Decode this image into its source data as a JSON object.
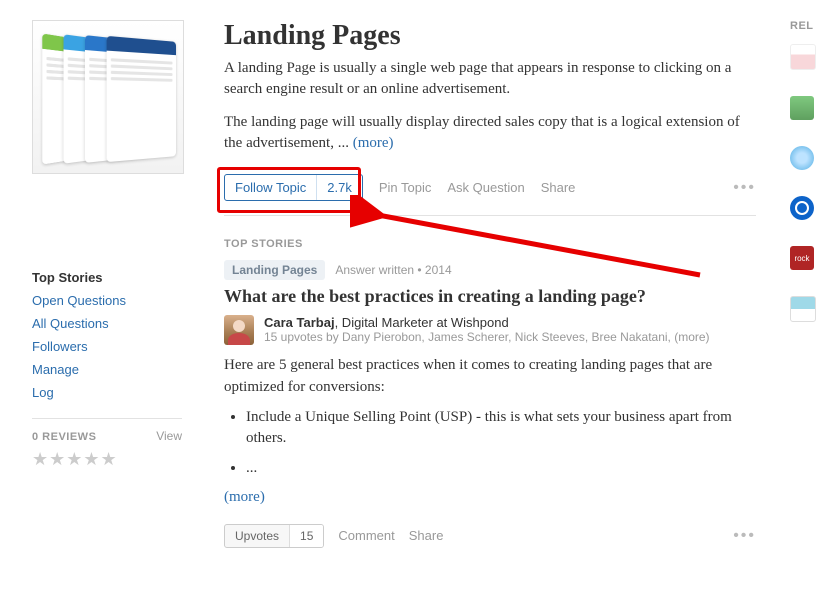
{
  "sidebar": {
    "heading": "Top Stories",
    "links": [
      "Open Questions",
      "All Questions",
      "Followers",
      "Manage",
      "Log"
    ],
    "reviews_label": "0 REVIEWS",
    "view_label": "View",
    "stars": "★★★★★"
  },
  "topic": {
    "title": "Landing Pages",
    "desc1": "A landing Page is usually a single web page that appears in response to clicking on a search engine result or an online advertisement.",
    "desc2_prefix": "The landing page will usually  display directed sales copy that is a logical extension of the  advertisement, ... ",
    "more": "(more)"
  },
  "actions": {
    "follow_label": "Follow Topic",
    "follow_count": "2.7k",
    "pin": "Pin Topic",
    "ask": "Ask Question",
    "share": "Share",
    "dots": "•••"
  },
  "section": {
    "top_stories": "TOP STORIES"
  },
  "story": {
    "pill": "Landing Pages",
    "meta": "Answer written • 2014",
    "title": "What are the best practices in creating a landing page?",
    "author_name": "Cara Tarbaj",
    "author_role": ", Digital Marketer at Wishpond",
    "author_sub_prefix": "15 upvotes by Dany Pierobon, James Scherer, Nick Steeves, Bree Nakatani, ",
    "author_sub_more": "(more)",
    "body": "Here are 5 general best practices when it comes to creating landing pages that are optimized for conversions:",
    "bullet1": "Include a Unique Selling Point (USP) - this is what sets your business apart from others.",
    "bullet2": "...",
    "more": "(more)"
  },
  "foot": {
    "upvote_label": "Upvotes",
    "upvote_count": "15",
    "comment": "Comment",
    "share": "Share",
    "dots": "•••"
  },
  "rail": {
    "label": "REL",
    "r5_text": "rock"
  }
}
